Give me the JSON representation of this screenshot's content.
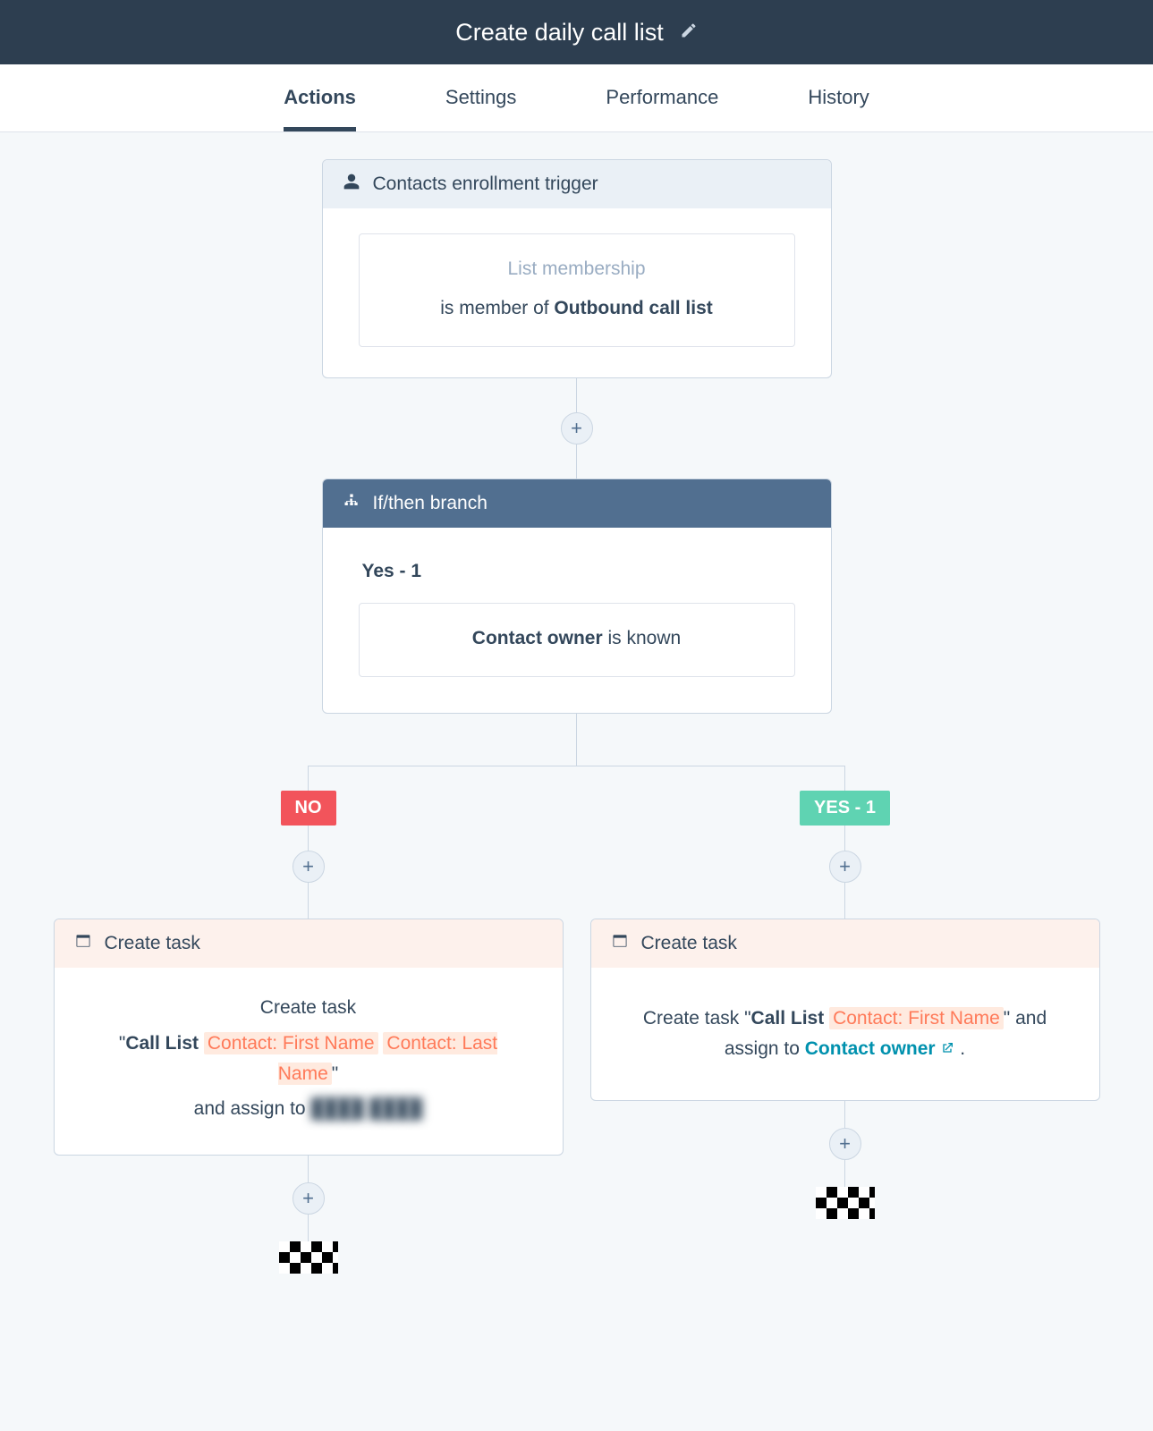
{
  "header": {
    "title": "Create daily call list"
  },
  "tabs": [
    {
      "label": "Actions",
      "active": true
    },
    {
      "label": "Settings",
      "active": false
    },
    {
      "label": "Performance",
      "active": false
    },
    {
      "label": "History",
      "active": false
    }
  ],
  "trigger": {
    "title": "Contacts enrollment trigger",
    "criteria_label": "List membership",
    "criteria_prefix": "is member of ",
    "criteria_value": "Outbound call list"
  },
  "branch": {
    "title": "If/then branch",
    "yes_label": "Yes - 1",
    "cond_bold": "Contact owner",
    "cond_tail": " is known"
  },
  "labels": {
    "no": "NO",
    "yes": "YES - 1"
  },
  "task_no": {
    "header": "Create task",
    "line1": "Create task",
    "prefix": "\"",
    "bold": "Call List ",
    "tok1": "Contact: First Name",
    "tok2": "Contact: Last Name",
    "suffix": "\"",
    "assign_text": "and assign to ",
    "assignee_masked": "████ ████"
  },
  "task_yes": {
    "header": "Create task",
    "prefix": "Create task \"",
    "bold": "Call List ",
    "tok1": "Contact: First Name",
    "mid": "\" and assign to ",
    "owner": "Contact owner",
    "tail": " ."
  }
}
